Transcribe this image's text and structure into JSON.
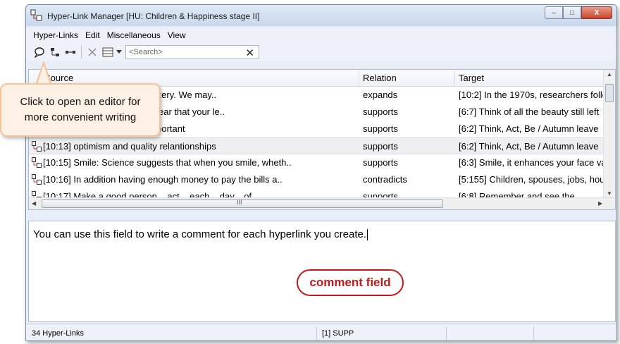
{
  "window": {
    "title": "Hyper-Link Manager [HU: Children & Happiness stage II]",
    "controls": {
      "minimize": "–",
      "maximize": "□",
      "close": "X"
    }
  },
  "menubar": {
    "items": [
      "Hyper-Links",
      "Edit",
      "Miscellaneous",
      "View"
    ]
  },
  "toolbar": {
    "icons": [
      "comment-editor-icon",
      "hierarchy-icon",
      "link-icon",
      "delete-icon",
      "table-view-icon"
    ],
    "search_placeholder": "<Search>",
    "search_clear": "✕"
  },
  "table": {
    "columns": [
      "Source",
      "Relation",
      "Target"
    ],
    "rows": [
      {
        "source": "[10:11] Imagine winning a lottery. We may..",
        "relation": "expands",
        "target": "[10:2] In the 1970s, researchers follo"
      },
      {
        "source": "[10:12] Research makes it clear that your le..",
        "relation": "supports",
        "target": "[6:7] Think of all the beauty still left"
      },
      {
        "source": "[10:13] Relationships are important",
        "relation": "supports",
        "target": "[6:2] Think, Act, Be / Autumn leave"
      },
      {
        "source": "[10:13] optimism and quality relantionships",
        "relation": "supports",
        "target": "[6:2] Think, Act, Be / Autumn leave"
      },
      {
        "source": "[10:15] Smile: Science suggests that when you smile, wheth..",
        "relation": "supports",
        "target": "[6:3] Smile, it enhances your face va"
      },
      {
        "source": "[10:16] In addition having enough money to pay the bills a..",
        "relation": "contradicts",
        "target": "[5:155] Children, spouses, jobs, hou"
      },
      {
        "source": "[10:17] Make a good person... act... each... day... of...",
        "relation": "supports",
        "target": "[6:8] Remember and see the..."
      }
    ],
    "selected_row": 3,
    "hscroll_grip": "III"
  },
  "comment": {
    "text": "You can use this field to write a comment for each hyperlink you create.",
    "badge": "comment field"
  },
  "statusbar": {
    "count": "34 Hyper-Links",
    "relation": "[1] SUPP"
  },
  "callout": {
    "text": "Click to open an editor for more convenient writing"
  }
}
